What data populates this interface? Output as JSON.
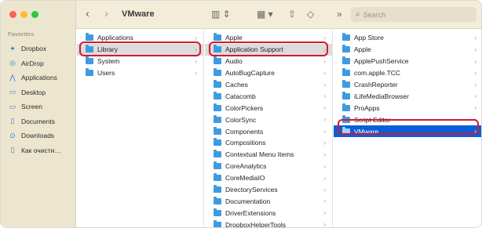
{
  "window": {
    "title": "VMware"
  },
  "sidebar": {
    "section_title": "Favorites",
    "items": [
      {
        "label": "Dropbox",
        "icon": "dropbox-icon"
      },
      {
        "label": "AirDrop",
        "icon": "airdrop-icon"
      },
      {
        "label": "Applications",
        "icon": "applications-icon"
      },
      {
        "label": "Desktop",
        "icon": "desktop-icon"
      },
      {
        "label": "Screen",
        "icon": "folder-icon"
      },
      {
        "label": "Documents",
        "icon": "document-icon"
      },
      {
        "label": "Downloads",
        "icon": "downloads-icon"
      },
      {
        "label": "Как очисти…",
        "icon": "document-icon"
      }
    ]
  },
  "toolbar": {
    "back": "‹",
    "forward": "›",
    "search_placeholder": "Search",
    "more": "»"
  },
  "columns": [
    {
      "items": [
        "Applications",
        "Library",
        "System",
        "Users"
      ],
      "selected": 1
    },
    {
      "items": [
        "Apple",
        "Application Support",
        "Audio",
        "AutoBugCapture",
        "Caches",
        "Catacomb",
        "ColorPickers",
        "ColorSync",
        "Components",
        "Compositions",
        "Contextual Menu Items",
        "CoreAnalytics",
        "CoreMediaIO",
        "DirectoryServices",
        "Documentation",
        "DriverExtensions",
        "DropboxHelperTools"
      ],
      "selected": 1
    },
    {
      "items": [
        "App Store",
        "Apple",
        "ApplePushService",
        "com.apple.TCC",
        "CrashReporter",
        "iLifeMediaBrowser",
        "ProApps",
        "Script Editor",
        "VMware"
      ],
      "selected": 8
    }
  ],
  "colors": {
    "accent": "#0a5fd8",
    "highlight": "#d5172b",
    "sidebar": "#ede6cf"
  }
}
